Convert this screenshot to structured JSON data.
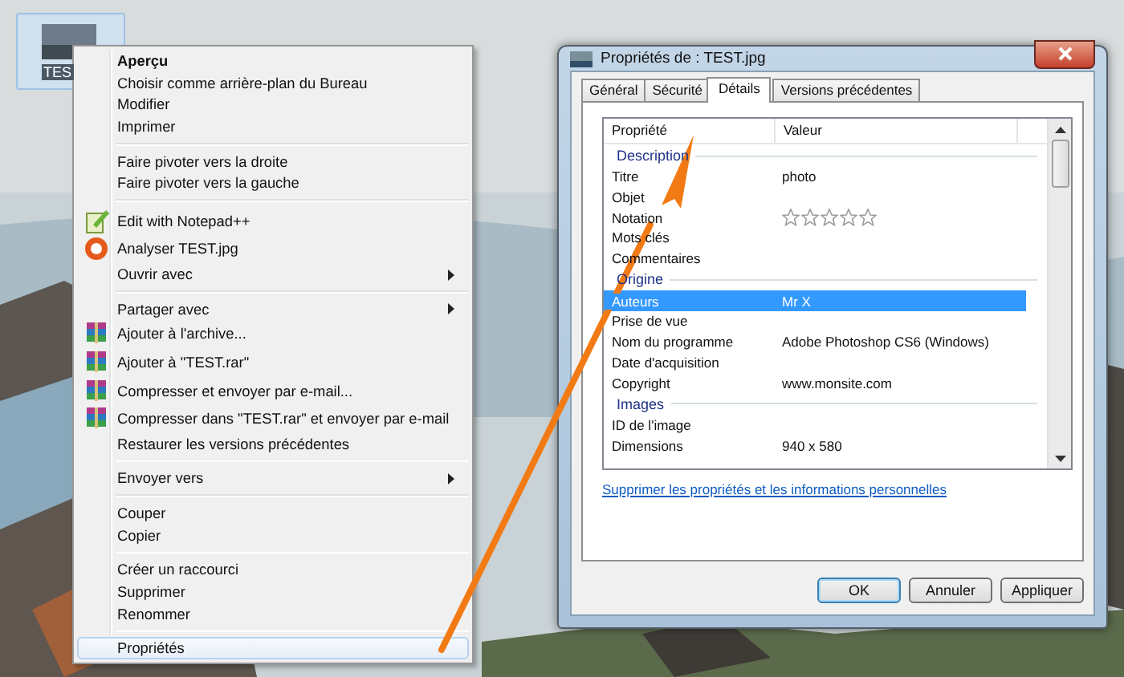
{
  "desktop_icon": {
    "label": "TES",
    "selected": true
  },
  "context_menu": [
    {
      "kind": "item",
      "label": "Aperçu",
      "default": true,
      "selected": false
    },
    {
      "kind": "item",
      "label": "Choisir comme arrière-plan du Bureau",
      "selected": false
    },
    {
      "kind": "item",
      "label": "Modifier",
      "selected": false
    },
    {
      "kind": "item",
      "label": "Imprimer",
      "selected": false
    },
    {
      "kind": "separator"
    },
    {
      "kind": "item",
      "label": "Faire pivoter vers la droite",
      "selected": false
    },
    {
      "kind": "item",
      "label": "Faire pivoter vers la gauche",
      "selected": false
    },
    {
      "kind": "separator"
    },
    {
      "kind": "notepad",
      "label": "Edit with Notepad++",
      "selected": false
    },
    {
      "kind": "scan",
      "label": "Analyser TEST.jpg",
      "selected": false
    },
    {
      "kind": "item",
      "label": "Ouvrir avec",
      "submenu": true,
      "selected": false
    },
    {
      "kind": "separator"
    },
    {
      "kind": "item",
      "label": "Partager avec",
      "submenu": true,
      "selected": false
    },
    {
      "kind": "archive",
      "label": "Ajouter à l'archive...",
      "selected": false
    },
    {
      "kind": "archive",
      "label": "Ajouter à \"TEST.rar\"",
      "selected": false
    },
    {
      "kind": "archive",
      "label": "Compresser et envoyer par e-mail...",
      "selected": false
    },
    {
      "kind": "archive",
      "label": "Compresser dans \"TEST.rar\" et envoyer par e-mail",
      "selected": false
    },
    {
      "kind": "item",
      "label": "Restaurer les versions précédentes",
      "selected": false
    },
    {
      "kind": "separator"
    },
    {
      "kind": "item",
      "label": "Envoyer vers",
      "submenu": true,
      "selected": false
    },
    {
      "kind": "separator"
    },
    {
      "kind": "item",
      "label": "Couper",
      "selected": false
    },
    {
      "kind": "item",
      "label": "Copier",
      "selected": false
    },
    {
      "kind": "separator"
    },
    {
      "kind": "item",
      "label": "Créer un raccourci",
      "selected": false
    },
    {
      "kind": "item",
      "label": "Supprimer",
      "selected": false
    },
    {
      "kind": "item",
      "label": "Renommer",
      "selected": false
    },
    {
      "kind": "separator"
    },
    {
      "kind": "item",
      "label": "Propriétés",
      "selected": true
    }
  ],
  "dialog": {
    "title": "Propriétés de : TEST.jpg",
    "tabs": [
      {
        "label": "Général",
        "selected": false
      },
      {
        "label": "Sécurité",
        "selected": false
      },
      {
        "label": "Détails",
        "selected": true
      },
      {
        "label": "Versions précédentes",
        "selected": false
      }
    ],
    "columns": [
      "Propriété",
      "Valeur"
    ],
    "rows": [
      {
        "kind": "group",
        "label": "Description"
      },
      {
        "kind": "row",
        "name": "Titre",
        "value": "photo",
        "selected": false
      },
      {
        "kind": "row",
        "name": "Objet",
        "selected": false
      },
      {
        "kind": "rating",
        "name": "Notation",
        "stars": 0,
        "selected": false
      },
      {
        "kind": "row",
        "name": "Mots clés",
        "selected": false
      },
      {
        "kind": "row",
        "name": "Commentaires",
        "selected": false
      },
      {
        "kind": "group",
        "label": "Origine"
      },
      {
        "kind": "row",
        "name": "Auteurs",
        "value": "Mr X",
        "selected": true
      },
      {
        "kind": "row",
        "name": "Prise de vue",
        "selected": false
      },
      {
        "kind": "row",
        "name": "Nom du programme",
        "value": "Adobe Photoshop CS6 (Windows)",
        "selected": false
      },
      {
        "kind": "row",
        "name": "Date d'acquisition",
        "selected": false
      },
      {
        "kind": "row",
        "name": "Copyright",
        "value": "www.monsite.com",
        "selected": false
      },
      {
        "kind": "group",
        "label": "Images"
      },
      {
        "kind": "row",
        "name": "ID de l'image",
        "selected": false
      },
      {
        "kind": "row",
        "name": "Dimensions",
        "value": "940 x 580",
        "selected": false
      }
    ],
    "link": "Supprimer les propriétés et les informations personnelles",
    "buttons": [
      {
        "label": "OK",
        "default": true
      },
      {
        "label": "Annuler",
        "default": false
      },
      {
        "label": "Appliquer",
        "default": false
      }
    ]
  }
}
